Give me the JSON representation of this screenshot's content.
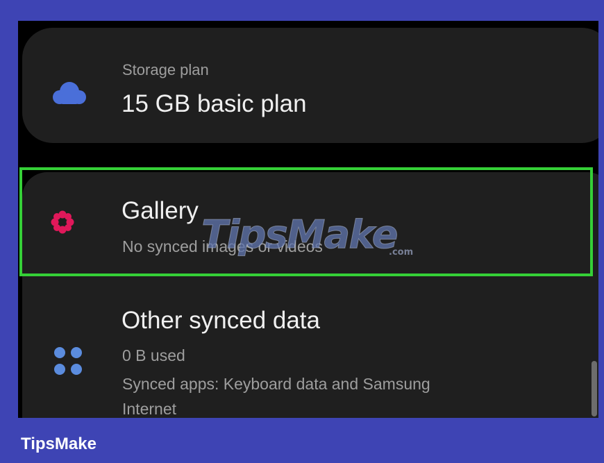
{
  "storage": {
    "label": "Storage plan",
    "value": "15 GB basic plan",
    "icon": "cloud-icon",
    "icon_color": "#4a6fd9"
  },
  "gallery": {
    "title": "Gallery",
    "subtitle": "No synced images or videos",
    "icon": "gallery-flower-icon",
    "icon_color": "#e0185a",
    "highlight_color": "#35d037"
  },
  "other": {
    "title": "Other synced data",
    "usage": "0 B  used",
    "apps_line1": "Synced apps: Keyboard data and Samsung",
    "apps_line2": "Internet",
    "icon": "apps-grid-icon",
    "icon_color": "#5b8cde"
  },
  "watermark": {
    "text": "TipsMake",
    "suffix": ".com"
  },
  "footer": {
    "brand": "TipsMake"
  }
}
